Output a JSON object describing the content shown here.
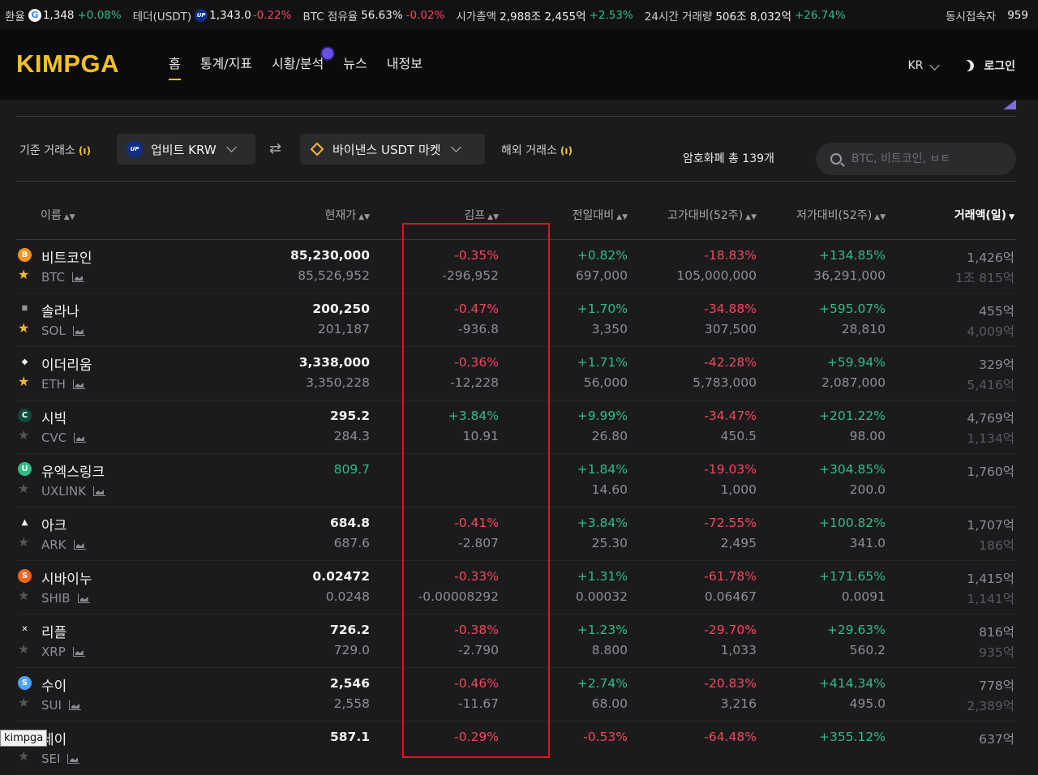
{
  "ticker": {
    "rate_label": "환율",
    "rate_icon": "G",
    "rate_value": "1,348",
    "rate_change": "+0.08%",
    "tether_label": "테더(USDT)",
    "tether_icon": "UP",
    "tether_value": "1,343.0",
    "tether_change": "-0.22%",
    "dom_label": "BTC 점유율",
    "dom_value": "56.63%",
    "dom_change": "-0.02%",
    "cap_label": "시가총액",
    "cap_value": "2,988조 2,455억",
    "cap_change": "+2.53%",
    "vol_label": "24시간 거래량",
    "vol_value": "506조 8,032억",
    "vol_change": "+26.74%",
    "users_label": "동시접속자",
    "users_value": "959"
  },
  "header": {
    "logo": "KIMPGA",
    "nav": [
      "홈",
      "통계/지표",
      "시황/분석",
      "뉴스",
      "내정보"
    ],
    "lang": "KR",
    "login": "로그인"
  },
  "filters": {
    "base_label": "기준 거래소",
    "base_icon": "UP",
    "base_value": "업비트 KRW",
    "target_value": "바이낸스 USDT 마켓",
    "foreign_label": "해외 거래소",
    "antenna": "(ı)",
    "swap": "⇄",
    "count_text": "암호화폐 총 139개",
    "search_placeholder": "BTC, 비트코인, ㅂㅌ"
  },
  "table": {
    "columns": [
      "이름",
      "현재가",
      "김프",
      "전일대비",
      "고가대비(52주)",
      "저가대비(52주)",
      "거래액(일)"
    ],
    "sort_icon": "▲▼",
    "sort_active_icon": "▼",
    "unit": "억",
    "rows": [
      {
        "name": "비트코인",
        "symbol": "BTC",
        "fav": true,
        "icon": "B",
        "color": "#f7931a",
        "price": "85,230,000",
        "price2": "85,526,952",
        "kimp": "-0.35%",
        "kimp2": "-296,952",
        "chg": "+0.82%",
        "chg2": "697,000",
        "high": "-18.83%",
        "high2": "105,000,000",
        "low": "+134.85%",
        "low2": "36,291,000",
        "vol": "1,426",
        "vol2": "1조 815"
      },
      {
        "name": "솔라나",
        "symbol": "SOL",
        "fav": true,
        "icon": "≡",
        "color": "#1a1a1a",
        "price": "200,250",
        "price2": "201,187",
        "kimp": "-0.47%",
        "kimp2": "-936.8",
        "chg": "+1.70%",
        "chg2": "3,350",
        "high": "-34.88%",
        "high2": "307,500",
        "low": "+595.07%",
        "low2": "28,810",
        "vol": "455",
        "vol2": "4,009"
      },
      {
        "name": "이더리움",
        "symbol": "ETH",
        "fav": true,
        "icon": "◆",
        "color": "#1b1b1d",
        "price": "3,338,000",
        "price2": "3,350,228",
        "kimp": "-0.36%",
        "kimp2": "-12,228",
        "chg": "+1.71%",
        "chg2": "56,000",
        "high": "-42.28%",
        "high2": "5,783,000",
        "low": "+59.94%",
        "low2": "2,087,000",
        "vol": "329",
        "vol2": "5,416"
      },
      {
        "name": "시빅",
        "symbol": "CVC",
        "fav": false,
        "icon": "C",
        "color": "#0f4a3c",
        "price": "295.2",
        "price2": "284.3",
        "kimp": "+3.84%",
        "kimp2": "10.91",
        "chg": "+9.99%",
        "chg2": "26.80",
        "high": "-34.47%",
        "high2": "450.5",
        "low": "+201.22%",
        "low2": "98.00",
        "vol": "4,769",
        "vol2": "1,134"
      },
      {
        "name": "유엑스링크",
        "symbol": "UXLINK",
        "fav": false,
        "icon": "U",
        "color": "#2ebd85",
        "price": "809.7",
        "price2": "",
        "kimp": "",
        "kimp2": "",
        "chg": "+1.84%",
        "chg2": "14.60",
        "high": "-19.03%",
        "high2": "1,000",
        "low": "+304.85%",
        "low2": "200.0",
        "vol": "1,760",
        "vol2": ""
      },
      {
        "name": "아크",
        "symbol": "ARK",
        "fav": false,
        "icon": "▲",
        "color": "#1b1b1d",
        "price": "684.8",
        "price2": "687.6",
        "kimp": "-0.41%",
        "kimp2": "-2.807",
        "chg": "+3.84%",
        "chg2": "25.30",
        "high": "-72.55%",
        "high2": "2,495",
        "low": "+100.82%",
        "low2": "341.0",
        "vol": "1,707",
        "vol2": "186"
      },
      {
        "name": "시바이누",
        "symbol": "SHIB",
        "fav": false,
        "icon": "S",
        "color": "#f0641e",
        "price": "0.02472",
        "price2": "0.0248",
        "kimp": "-0.33%",
        "kimp2": "-0.00008292",
        "chg": "+1.31%",
        "chg2": "0.00032",
        "high": "-61.78%",
        "high2": "0.06467",
        "low": "+171.65%",
        "low2": "0.0091",
        "vol": "1,415",
        "vol2": "1,141"
      },
      {
        "name": "리플",
        "symbol": "XRP",
        "fav": false,
        "icon": "✕",
        "color": "#1b1b1d",
        "price": "726.2",
        "price2": "729.0",
        "kimp": "-0.38%",
        "kimp2": "-2.790",
        "chg": "+1.23%",
        "chg2": "8.800",
        "high": "-29.70%",
        "high2": "1,033",
        "low": "+29.63%",
        "low2": "560.2",
        "vol": "816",
        "vol2": "935"
      },
      {
        "name": "수이",
        "symbol": "SUI",
        "fav": false,
        "icon": "S",
        "color": "#4da2ff",
        "price": "2,546",
        "price2": "2,558",
        "kimp": "-0.46%",
        "kimp2": "-11.67",
        "chg": "+2.74%",
        "chg2": "68.00",
        "high": "-20.83%",
        "high2": "3,216",
        "low": "+414.34%",
        "low2": "495.0",
        "vol": "778",
        "vol2": "2,389"
      },
      {
        "name": "세이",
        "symbol": "SEI",
        "fav": false,
        "icon": "S",
        "color": "#9b1c2e",
        "price": "587.1",
        "price2": "",
        "kimp": "-0.29%",
        "kimp2": "",
        "chg": "-0.53%",
        "chg2": "",
        "high": "-64.48%",
        "high2": "",
        "low": "+355.12%",
        "low2": "",
        "vol": "637",
        "vol2": ""
      }
    ]
  },
  "tooltip": "kimpga",
  "colors": {
    "accent": "#f3c222",
    "up": "#2ebd85",
    "down": "#f6465d",
    "highlight": "#e0141e"
  }
}
